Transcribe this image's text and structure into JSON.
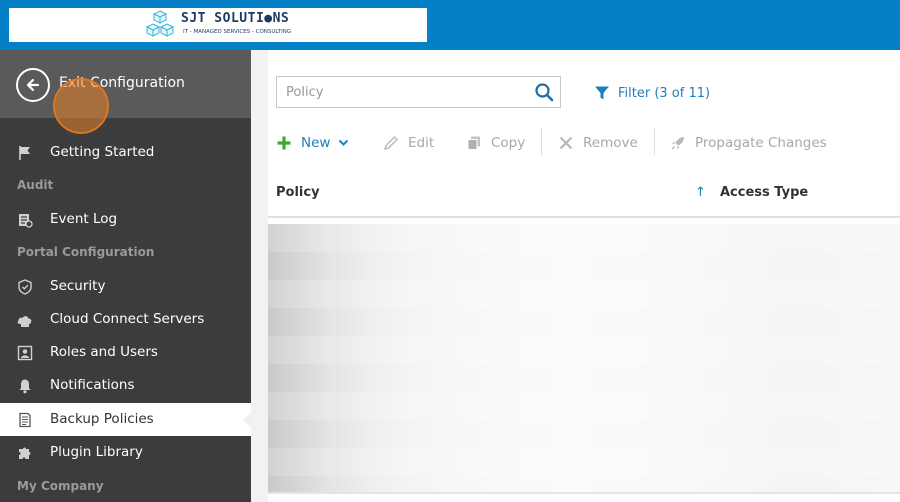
{
  "header": {
    "logo_title": "SJT SOLUTI●NS",
    "logo_subtitle": "IT - MANAGED SERVICES - CONSULTING",
    "bar_color": "#0580c6"
  },
  "sidebar": {
    "exit_label": "Exit Configuration",
    "exit_icon": "arrow-left-circle-icon",
    "items": [
      {
        "type": "item",
        "label": "Getting Started",
        "icon": "flag-icon",
        "active": false
      },
      {
        "type": "section",
        "label": "Audit"
      },
      {
        "type": "item",
        "label": "Event Log",
        "icon": "log-icon",
        "active": false
      },
      {
        "type": "section",
        "label": "Portal Configuration"
      },
      {
        "type": "item",
        "label": "Security",
        "icon": "shield-icon",
        "active": false
      },
      {
        "type": "item",
        "label": "Cloud Connect Servers",
        "icon": "cloud-icon",
        "active": false
      },
      {
        "type": "item",
        "label": "Roles and Users",
        "icon": "id-card-icon",
        "active": false
      },
      {
        "type": "item",
        "label": "Notifications",
        "icon": "bell-icon",
        "active": false
      },
      {
        "type": "item",
        "label": "Backup Policies",
        "icon": "document-icon",
        "active": true
      },
      {
        "type": "item",
        "label": "Plugin Library",
        "icon": "puzzle-icon",
        "active": false
      },
      {
        "type": "section",
        "label": "My Company"
      }
    ]
  },
  "search": {
    "placeholder": "Policy",
    "value": ""
  },
  "filter": {
    "label": "Filter (3 of 11)"
  },
  "toolbar": {
    "new_label": "New",
    "edit_label": "Edit",
    "copy_label": "Copy",
    "remove_label": "Remove",
    "propagate_label": "Propagate Changes"
  },
  "table": {
    "columns": [
      "Policy",
      "Access Type"
    ],
    "sort_indicator": "↑"
  },
  "colors": {
    "accent": "#1e7fb8",
    "sidebar_bg": "#3c3c3c",
    "click_highlight": "#e88228",
    "new_plus": "#3aaa35"
  }
}
